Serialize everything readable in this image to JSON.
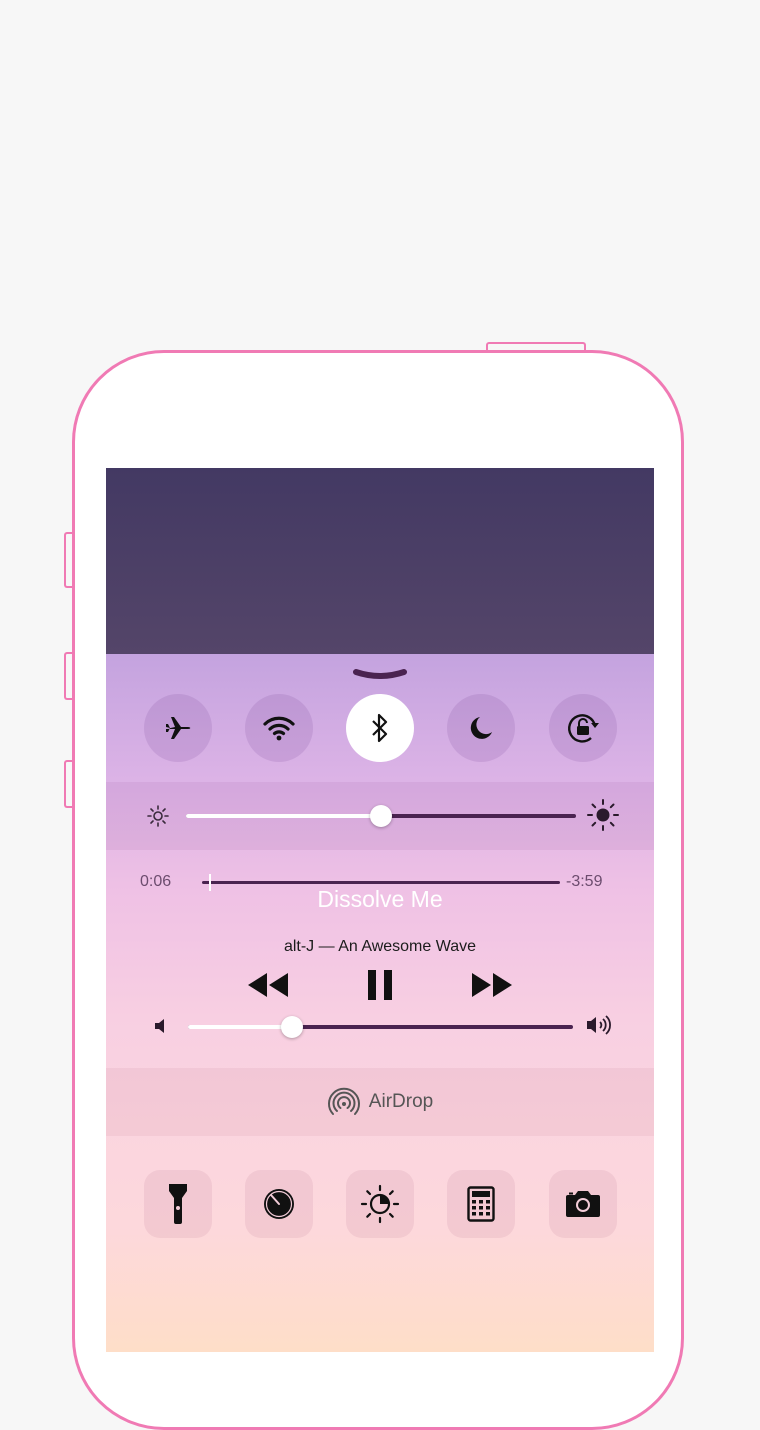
{
  "device": {
    "outline_color": "#f07ab4"
  },
  "control_center": {
    "toggles": [
      {
        "name": "airplane-mode",
        "icon": "airplane-icon",
        "active": false
      },
      {
        "name": "wifi",
        "icon": "wifi-icon",
        "active": false
      },
      {
        "name": "bluetooth",
        "icon": "bluetooth-icon",
        "active": true
      },
      {
        "name": "do-not-disturb",
        "icon": "moon-icon",
        "active": false
      },
      {
        "name": "rotation-lock",
        "icon": "rotation-lock-icon",
        "active": false
      }
    ],
    "brightness": {
      "level": 0.5,
      "min_icon": "sun-small-icon",
      "max_icon": "sun-large-icon"
    },
    "now_playing": {
      "elapsed": "0:06",
      "remaining": "-3:59",
      "progress": 0.02,
      "title": "Dissolve Me",
      "subtitle": "alt-J — An Awesome Wave",
      "controls": [
        "rewind-icon",
        "pause-icon",
        "fast-forward-icon"
      ]
    },
    "volume": {
      "level": 0.27,
      "min_icon": "speaker-low-icon",
      "max_icon": "speaker-high-icon"
    },
    "airdrop": {
      "label": "AirDrop",
      "icon": "airdrop-icon"
    },
    "tools": [
      {
        "name": "flashlight",
        "icon": "flashlight-icon"
      },
      {
        "name": "timer",
        "icon": "timer-icon"
      },
      {
        "name": "night-shift",
        "icon": "night-shift-icon"
      },
      {
        "name": "calculator",
        "icon": "calculator-icon"
      },
      {
        "name": "camera",
        "icon": "camera-icon"
      }
    ],
    "colors": {
      "wallpaper_top": "#433963",
      "track_dark": "#4a2350",
      "active_toggle": "#ffffff"
    }
  }
}
